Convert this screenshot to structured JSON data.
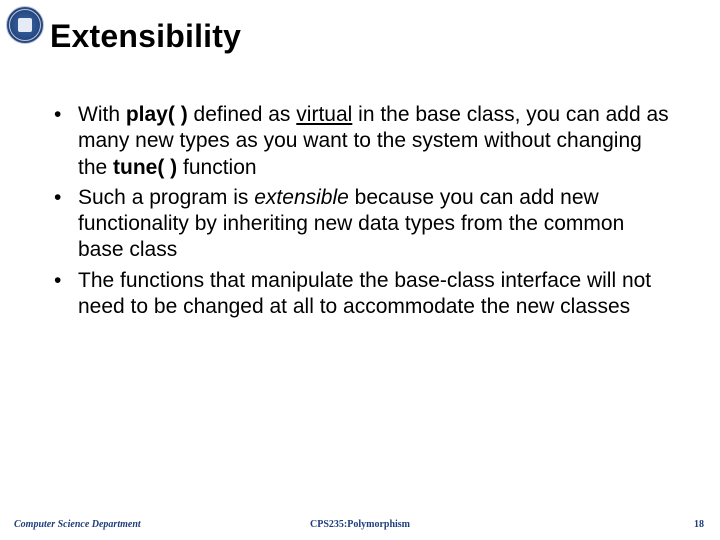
{
  "title": "Extensibility",
  "bullets": [
    {
      "pre": "With ",
      "b1": "play( )",
      "mid1": " defined as ",
      "u1": "virtual",
      "mid2": " in the base class, you can add as many new types as you want to the system without changing the ",
      "b2": "tune( )",
      "post": " function"
    },
    {
      "pre": "Such a program is ",
      "i1": "extensible",
      "post": " because you can add new functionality by inheriting new data types from the common base class"
    },
    {
      "full": "The functions that manipulate the base-class interface will not need to be changed at all to accommodate the new classes"
    }
  ],
  "footer": {
    "left": "Computer Science Department",
    "center": "CPS235:Polymorphism",
    "right": "18"
  }
}
